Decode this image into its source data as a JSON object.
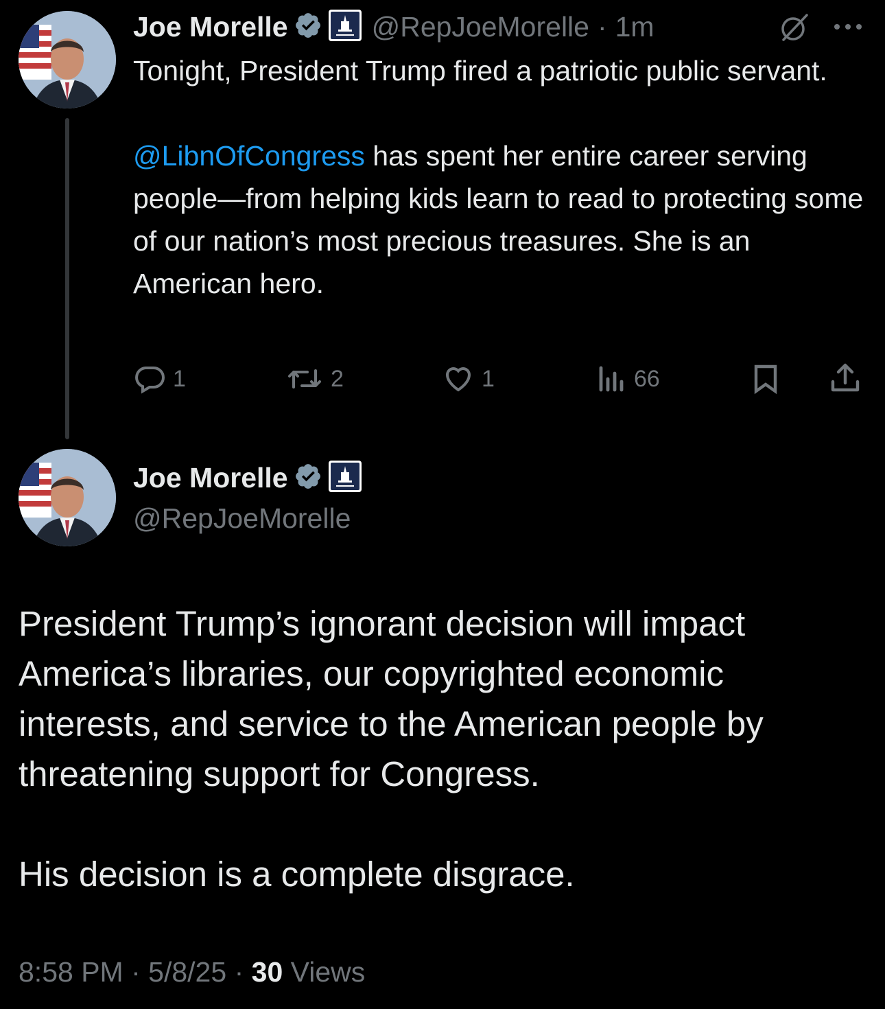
{
  "reply_tweet": {
    "author_name": "Joe Morelle",
    "handle": "@RepJoeMorelle",
    "separator": "·",
    "time": "1m",
    "text_line1": "Tonight, President Trump fired a patriotic public servant.",
    "mention": "@LibnOfCongress",
    "text_line2_rest": " has spent her entire career serving people—from helping kids learn to read to protecting some of our nation’s most precious treasures. She is an American hero.",
    "actions": {
      "replies": "1",
      "reposts": "2",
      "likes": "1",
      "views": "66"
    }
  },
  "main_tweet": {
    "author_name": "Joe Morelle",
    "handle": "@RepJoeMorelle",
    "paragraph1": "President Trump’s ignorant decision will impact America’s libraries, our copyrighted economic interests, and service to the American people by threatening support for Congress.",
    "paragraph2": "His decision is a complete disgrace.",
    "timestamp": "8:58 PM",
    "date": "5/8/25",
    "dot": "·",
    "views_count": "30",
    "views_label": "Views"
  },
  "colors": {
    "background": "#000000",
    "text": "#e7e9ea",
    "secondary": "#71767b",
    "link": "#1d9bf0",
    "verified": "#829aab"
  },
  "icons": [
    "verified-badge-icon",
    "house-democrats-affiliate-icon",
    "grok-icon",
    "more-icon",
    "reply-icon",
    "repost-icon",
    "like-icon",
    "views-icon",
    "bookmark-icon",
    "share-icon"
  ]
}
